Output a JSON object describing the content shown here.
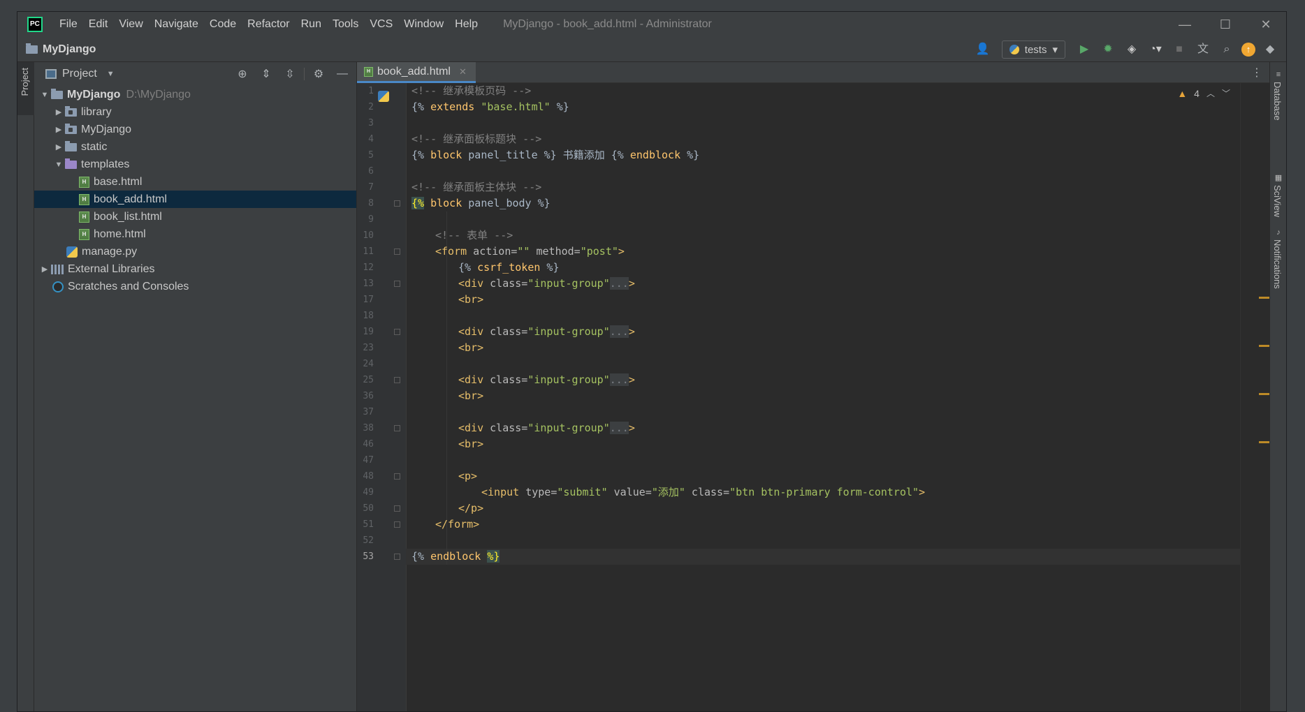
{
  "titlebar": {
    "logo": "PC",
    "menu": [
      "File",
      "Edit",
      "View",
      "Navigate",
      "Code",
      "Refactor",
      "Run",
      "Tools",
      "VCS",
      "Window",
      "Help"
    ],
    "window_title": "MyDjango - book_add.html - Administrator",
    "controls": {
      "minimize": "—",
      "maximize": "☐",
      "close": "✕"
    }
  },
  "navbar": {
    "project": "MyDjango",
    "run_config": "tests"
  },
  "left_strip": {
    "tab": "Project"
  },
  "project_panel": {
    "title": "Project",
    "tree": [
      {
        "label": "MyDjango",
        "hint": "D:\\MyDjango"
      },
      {
        "label": "library"
      },
      {
        "label": "MyDjango"
      },
      {
        "label": "static"
      },
      {
        "label": "templates"
      },
      {
        "label": "base.html"
      },
      {
        "label": "book_add.html"
      },
      {
        "label": "book_list.html"
      },
      {
        "label": "home.html"
      },
      {
        "label": "manage.py"
      },
      {
        "label": "External Libraries"
      },
      {
        "label": "Scratches and Consoles"
      }
    ]
  },
  "editor": {
    "tab": {
      "label": "book_add.html",
      "file_icon": "html-file-icon"
    },
    "warnings": "4",
    "line_numbers": [
      "1",
      "2",
      "3",
      "4",
      "5",
      "6",
      "7",
      "8",
      "9",
      "10",
      "11",
      "12",
      "13",
      "17",
      "18",
      "19",
      "23",
      "24",
      "25",
      "36",
      "37",
      "38",
      "46",
      "47",
      "48",
      "49",
      "50",
      "51",
      "52",
      "53"
    ],
    "code": {
      "l1": "<!-- 继承模板页码 -->",
      "l2a": "{% ",
      "l2b": "extends",
      "l2c": " ",
      "l2d": "\"base.html\"",
      "l2e": " %}",
      "l4": "<!-- 继承面板标题块 -->",
      "l5a": "{% ",
      "l5b": "block",
      "l5c": " panel_title %} 书籍添加 {% ",
      "l5d": "endblock",
      "l5e": " %}",
      "l7": "<!-- 继承面板主体块 -->",
      "l8a": "{%",
      "l8b": " ",
      "l8c": "block",
      "l8d": " panel_body %}",
      "l10": "<!-- 表单 -->",
      "l11a": "<form",
      "l11b": " action=",
      "l11c": "\"\"",
      "l11d": " method=",
      "l11e": "\"post\"",
      "l11f": ">",
      "l12a": "{% ",
      "l12b": "csrf_token",
      "l12c": " %}",
      "div_a": "<div",
      "div_b": " class=",
      "div_c": "\"input-group\"",
      "div_d": "...",
      "div_e": ">",
      "br": "<br>",
      "p_open": "<p>",
      "l49a": "<input",
      "l49b": " type=",
      "l49c": "\"submit\"",
      "l49d": " value=",
      "l49e": "\"添加\"",
      "l49f": " class=",
      "l49g": "\"btn btn-primary form-control\"",
      "l49h": ">",
      "p_close": "</p>",
      "form_close": "</form>",
      "l53a": "{% ",
      "l53b": "endblock",
      "l53c": " ",
      "l53d": "%}"
    }
  },
  "right_strip": [
    "Database",
    "SciView",
    "Notifications"
  ],
  "colors": {
    "background": "#2b2b2b",
    "panel": "#3c3f41",
    "selection": "#0d293e",
    "tag": "#e8bf6a",
    "string": "#a5c261",
    "comment": "#808080",
    "keyword": "#ffc66d",
    "warning": "#e6a43a"
  }
}
